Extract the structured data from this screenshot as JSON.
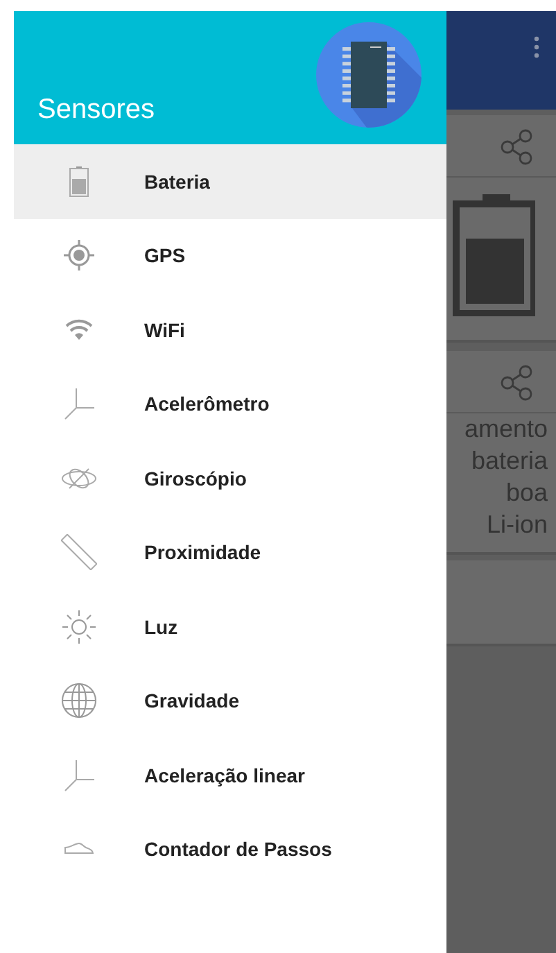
{
  "drawer": {
    "title": "Sensores",
    "items": [
      {
        "label": "Bateria",
        "kind": "battery",
        "selected": true
      },
      {
        "label": "GPS",
        "kind": "gps",
        "selected": false
      },
      {
        "label": "WiFi",
        "kind": "wifi",
        "selected": false
      },
      {
        "label": "Acelerômetro",
        "kind": "axes",
        "selected": false
      },
      {
        "label": "Giroscópio",
        "kind": "gyro",
        "selected": false
      },
      {
        "label": "Proximidade",
        "kind": "ruler",
        "selected": false
      },
      {
        "label": "Luz",
        "kind": "sun",
        "selected": false
      },
      {
        "label": "Gravidade",
        "kind": "globe",
        "selected": false
      },
      {
        "label": "Aceleração linear",
        "kind": "axes",
        "selected": false
      },
      {
        "label": "Contador de Passos",
        "kind": "shoe",
        "selected": false
      }
    ]
  },
  "background": {
    "card_lines": [
      "amento",
      "bateria",
      "boa",
      "Li-ion"
    ]
  }
}
